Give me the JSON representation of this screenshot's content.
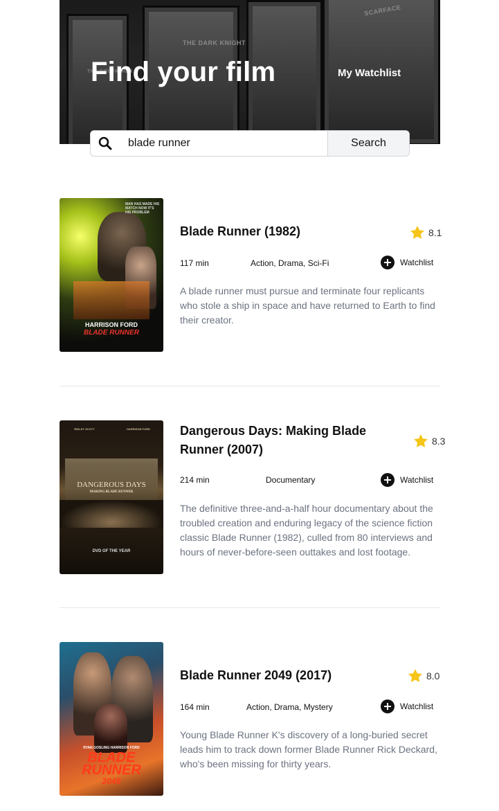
{
  "header": {
    "title": "Find your film",
    "watchlist_link": "My Watchlist",
    "background_labels": [
      "THE DARK KNIGHT",
      "SCARFACE",
      "THE GODFATHER"
    ]
  },
  "search": {
    "value": "blade runner",
    "placeholder": "",
    "button_label": "Search",
    "icon": "search-icon"
  },
  "results": [
    {
      "title": "Blade Runner (1982)",
      "rating": "8.1",
      "runtime": "117 min",
      "genres": "Action, Drama, Sci-Fi",
      "watchlist_label": "Watchlist",
      "description": "A blade runner must pursue and terminate four replicants who stole a ship in space and have returned to Earth to find their creator.",
      "poster": {
        "top_text": "MAN HAS MADE HIS MATCH NOW IT'S HIS PROBLEM",
        "actor": "HARRISON FORD",
        "title": "BLADE RUNNER"
      }
    },
    {
      "title": "Dangerous Days: Making Blade Runner (2007)",
      "rating": "8.3",
      "runtime": "214 min",
      "genres": "Documentary",
      "watchlist_label": "Watchlist",
      "description": "The definitive three-and-a-half hour documentary about the troubled creation and enduring legacy of the science fiction classic Blade Runner (1982), culled from 80 interviews and hours of never-before-seen outtakes and lost footage.",
      "poster": {
        "title": "DANGEROUS DAYS",
        "subtitle": "MAKING BLADE RUNNER",
        "credits_left": "RIDLEY SCOTT",
        "credits_right": "HARRISON FORD",
        "footer": "DVD OF THE YEAR"
      }
    },
    {
      "title": "Blade Runner 2049 (2017)",
      "rating": "8.0",
      "runtime": "164 min",
      "genres": "Action, Drama, Mystery",
      "watchlist_label": "Watchlist",
      "description": "Young Blade Runner K's discovery of a long-buried secret leads him to track down former Blade Runner Rick Deckard, who's been missing for thirty years.",
      "poster": {
        "actors": "RYAN GOSLING   HARRISON FORD",
        "title_line1": "BLADE",
        "title_line2": "RUNNER",
        "title_line3": "2049"
      }
    }
  ],
  "colors": {
    "star": "#f5c518",
    "description_text": "#6b7280",
    "divider": "#e5e7eb"
  }
}
